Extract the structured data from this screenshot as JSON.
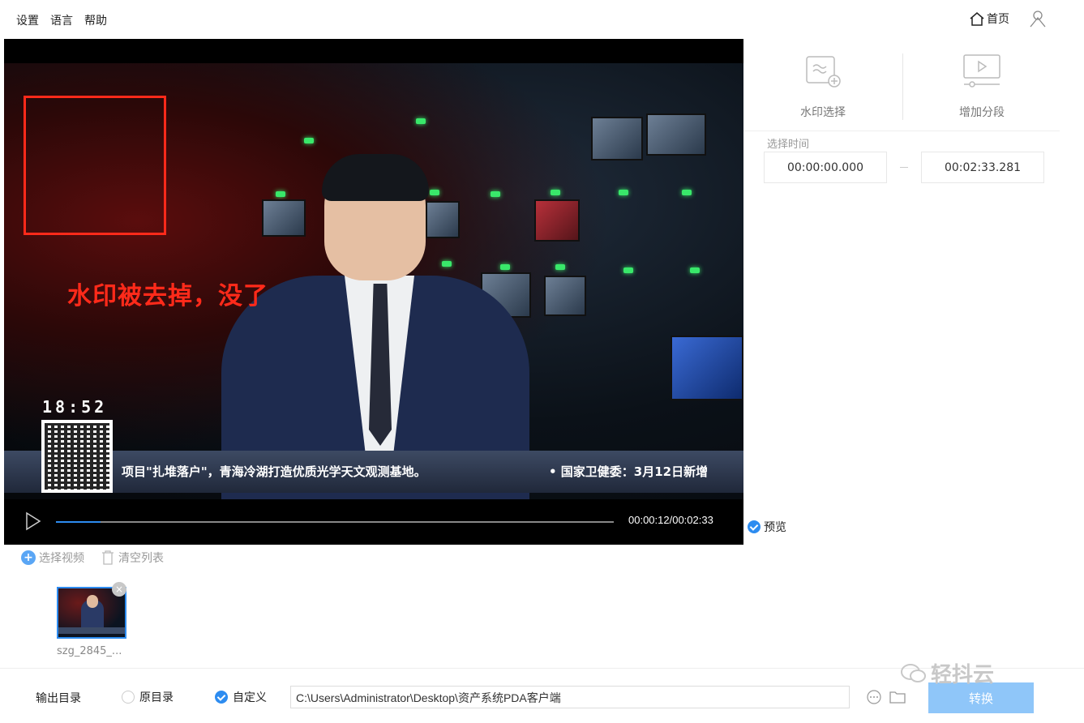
{
  "menu": {
    "settings": "设置",
    "language": "语言",
    "help": "帮助"
  },
  "header": {
    "home_label": "首页"
  },
  "video": {
    "annotation": "水印被去掉，没了",
    "clock": "18:52",
    "ticker_left": "项目\"扎堆落户\"，青海冷湖打造优质光学天文观测基地。",
    "ticker_right": "• 国家卫健委：3月12日新增",
    "timecode": "00:00:12/00:02:33",
    "progress": 0.08
  },
  "tools": {
    "watermark_select": "水印选择",
    "add_segment": "增加分段"
  },
  "time_select": {
    "label": "选择时间",
    "start": "00:00:00.000",
    "end": "00:02:33.281"
  },
  "preview": {
    "label": "预览",
    "checked": true
  },
  "list": {
    "select_video": "选择视频",
    "clear_list": "清空列表",
    "items": [
      {
        "name": "szg_2845_..."
      }
    ]
  },
  "output": {
    "label": "输出目录",
    "original_dir": "原目录",
    "custom": "自定义",
    "path": "C:\\Users\\Administrator\\Desktop\\资产系统PDA客户端",
    "convert_label": "转换"
  },
  "watermark_brand": "轻抖云",
  "colors": {
    "accent": "#2d8cf0",
    "annotation": "#ff2a1a",
    "convert_bg": "#8fc6f9"
  }
}
